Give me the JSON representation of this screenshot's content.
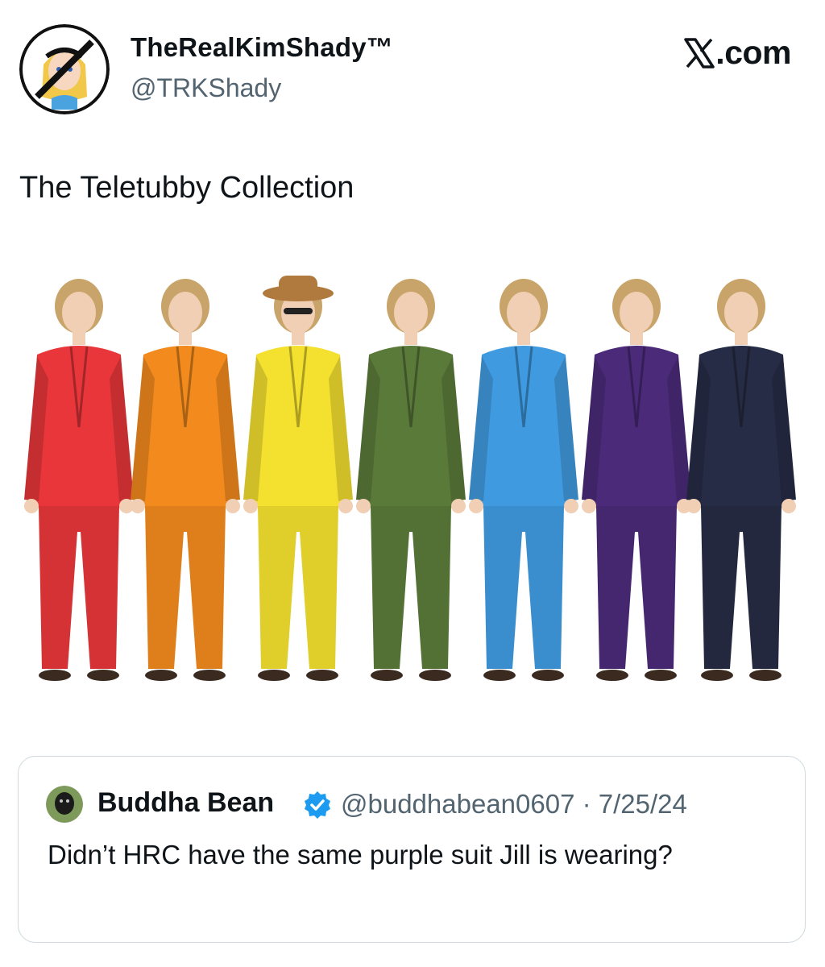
{
  "author": {
    "display_name": "TheRealKimShady™",
    "handle": "@TRKShady"
  },
  "brand": {
    "label": ".com"
  },
  "tweet": {
    "text": "The Teletubby Collection"
  },
  "media": {
    "suit_colors": [
      "#e8363a",
      "#f28a1d",
      "#f3e02f",
      "#5a7a3a",
      "#3f9ae0",
      "#4b2a7a",
      "#262c45"
    ]
  },
  "quoted_tweet": {
    "display_name": "Buddha Bean",
    "meta": "@buddhabean0607 · 7/25/24",
    "text": "Didn’t HRC have the same purple suit Jill is wearing?",
    "verified_color": "#1d9bf0"
  },
  "colors": {
    "text_primary": "#0f1419",
    "text_secondary": "#536471",
    "border": "#cfd9de"
  }
}
